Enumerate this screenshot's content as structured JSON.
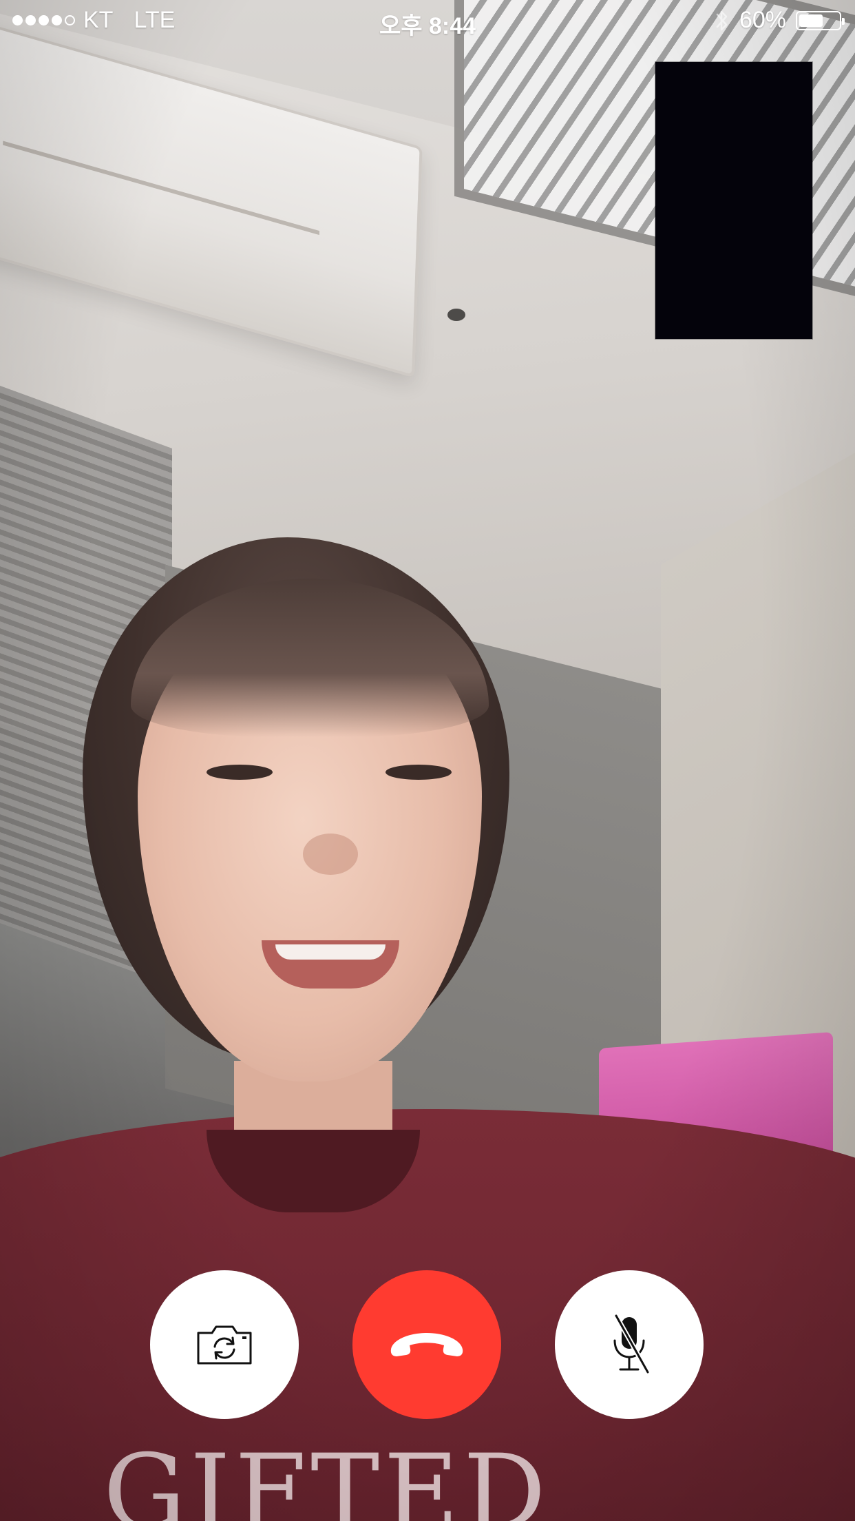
{
  "status_bar": {
    "signal_dots": [
      1,
      1,
      1,
      1,
      0
    ],
    "carrier": "KT",
    "network": "LTE",
    "time": "오후 8:44",
    "bluetooth_icon": "bluetooth-icon",
    "battery_percent": "60%",
    "battery_level": 0.6
  },
  "call": {
    "remote_video": "remote-video-feed",
    "self_preview": "self-camera-preview",
    "shirt_print": "GIFTED"
  },
  "controls": {
    "flip_camera_icon": "camera-flip-icon",
    "end_call_icon": "phone-hangup-icon",
    "mute_icon": "microphone-muted-icon",
    "end_call_color": "#ff3b30"
  }
}
